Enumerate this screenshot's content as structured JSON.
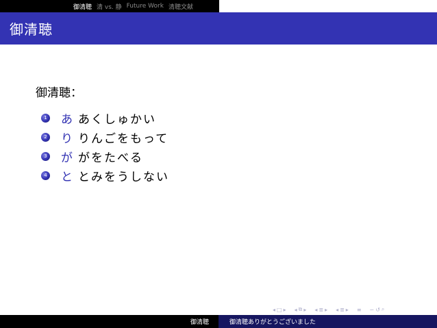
{
  "topnav": {
    "items": [
      "御清聴",
      "清 vs. 静",
      "Future Work",
      "清聴文献"
    ],
    "active_index": 0
  },
  "frame": {
    "title": "御清聴"
  },
  "content": {
    "intro": "御清聴：",
    "items": [
      {
        "number": "1",
        "term": "あ",
        "text": "あくしゅかい"
      },
      {
        "number": "2",
        "term": "り",
        "text": "りんごをもって"
      },
      {
        "number": "3",
        "term": "が",
        "text": "がをたべる"
      },
      {
        "number": "4",
        "term": "と",
        "text": "とみをうしない"
      }
    ]
  },
  "navsymbols": {
    "frame_prev": "◂",
    "frame_icon": "□",
    "frame_next": "▸",
    "subsection_prev": "◂",
    "subsection_icon": "⧉",
    "subsection_next": "▸",
    "section_prev": "◂",
    "section_icon": "≣",
    "section_next": "▸",
    "subsub_prev": "◂",
    "subsub_icon": "≣",
    "subsub_next": "▸",
    "toc_icon": "≡",
    "search_icon": "∽",
    "back_icon": "↺",
    "zoom_icon": "⌕"
  },
  "footer": {
    "left": "御清聴",
    "right": "御清聴ありがとうございました"
  },
  "colors": {
    "accent": "#3333b3",
    "footer_right_bg": "#161660",
    "black": "#000000"
  }
}
